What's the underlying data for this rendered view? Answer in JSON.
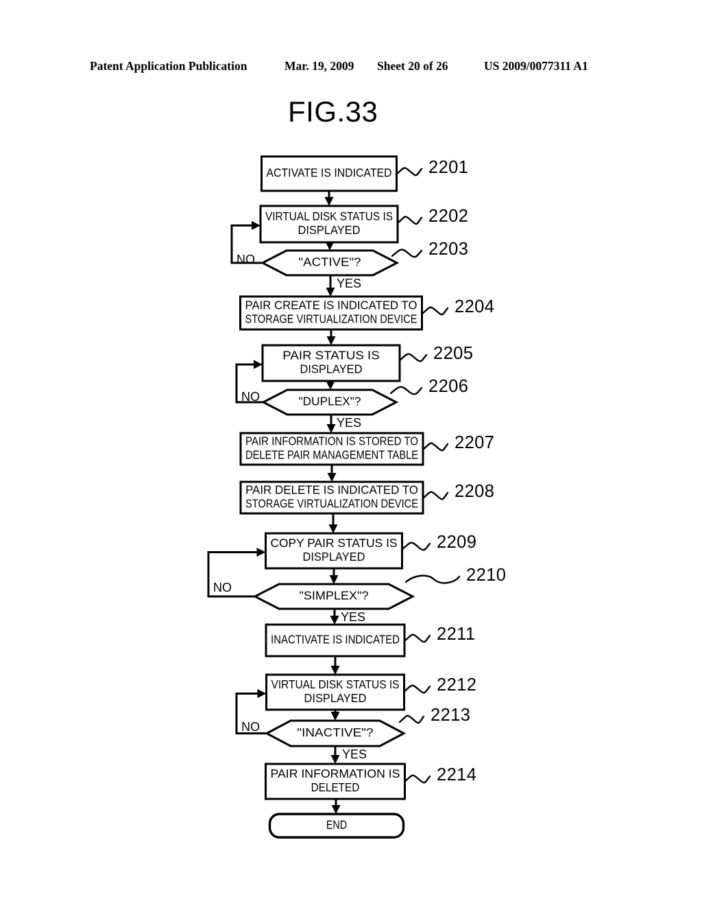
{
  "header": {
    "publication": "Patent Application Publication",
    "date": "Mar. 19, 2009",
    "sheet": "Sheet 20 of 26",
    "patent_number": "US 2009/0077311 A1"
  },
  "figure": {
    "title": "FIG.33",
    "ink_color": "#000000",
    "background_color": "#ffffff"
  },
  "flowchart": {
    "nodes": [
      {
        "id": "n2201",
        "ref": "2201",
        "shape": "process",
        "lines": [
          "ACTIVATE IS INDICATED"
        ]
      },
      {
        "id": "n2202",
        "ref": "2202",
        "shape": "process",
        "lines": [
          "VIRTUAL DISK STATUS IS",
          "DISPLAYED"
        ]
      },
      {
        "id": "n2203",
        "ref": "2203",
        "shape": "decision",
        "lines": [
          "\"ACTIVE\"?"
        ]
      },
      {
        "id": "n2204",
        "ref": "2204",
        "shape": "process",
        "lines": [
          "PAIR CREATE IS INDICATED TO",
          "STORAGE VIRTUALIZATION DEVICE"
        ]
      },
      {
        "id": "n2205",
        "ref": "2205",
        "shape": "process",
        "lines": [
          "PAIR STATUS IS",
          "DISPLAYED"
        ]
      },
      {
        "id": "n2206",
        "ref": "2206",
        "shape": "decision",
        "lines": [
          "\"DUPLEX\"?"
        ]
      },
      {
        "id": "n2207",
        "ref": "2207",
        "shape": "process",
        "lines": [
          "PAIR INFORMATION IS STORED TO",
          "DELETE PAIR MANAGEMENT TABLE"
        ]
      },
      {
        "id": "n2208",
        "ref": "2208",
        "shape": "process",
        "lines": [
          "PAIR DELETE IS INDICATED TO",
          "STORAGE VIRTUALIZATION DEVICE"
        ]
      },
      {
        "id": "n2209",
        "ref": "2209",
        "shape": "process",
        "lines": [
          "COPY PAIR STATUS IS",
          "DISPLAYED"
        ]
      },
      {
        "id": "n2210",
        "ref": "2210",
        "shape": "decision",
        "lines": [
          "\"SIMPLEX\"?"
        ]
      },
      {
        "id": "n2211",
        "ref": "2211",
        "shape": "process",
        "lines": [
          "INACTIVATE IS INDICATED"
        ]
      },
      {
        "id": "n2212",
        "ref": "2212",
        "shape": "process",
        "lines": [
          "VIRTUAL DISK STATUS IS",
          "DISPLAYED"
        ]
      },
      {
        "id": "n2213",
        "ref": "2213",
        "shape": "decision",
        "lines": [
          "\"INACTIVE\"?"
        ]
      },
      {
        "id": "n2214",
        "ref": "2214",
        "shape": "process",
        "lines": [
          "PAIR INFORMATION IS",
          "DELETED"
        ]
      },
      {
        "id": "nend",
        "ref": "",
        "shape": "terminator",
        "lines": [
          "END"
        ]
      }
    ],
    "branch_labels": {
      "yes": "YES",
      "no": "NO"
    },
    "edges": [
      {
        "from": "n2201",
        "to": "n2202",
        "label": ""
      },
      {
        "from": "n2202",
        "to": "n2203",
        "label": ""
      },
      {
        "from": "n2203",
        "to": "n2204",
        "label": "YES"
      },
      {
        "from": "n2203",
        "to": "n2202",
        "label": "NO"
      },
      {
        "from": "n2204",
        "to": "n2205",
        "label": ""
      },
      {
        "from": "n2205",
        "to": "n2206",
        "label": ""
      },
      {
        "from": "n2206",
        "to": "n2207",
        "label": "YES"
      },
      {
        "from": "n2206",
        "to": "n2205",
        "label": "NO"
      },
      {
        "from": "n2207",
        "to": "n2208",
        "label": ""
      },
      {
        "from": "n2208",
        "to": "n2209",
        "label": ""
      },
      {
        "from": "n2209",
        "to": "n2210",
        "label": ""
      },
      {
        "from": "n2210",
        "to": "n2211",
        "label": "YES"
      },
      {
        "from": "n2210",
        "to": "n2209",
        "label": "NO"
      },
      {
        "from": "n2211",
        "to": "n2212",
        "label": ""
      },
      {
        "from": "n2212",
        "to": "n2213",
        "label": ""
      },
      {
        "from": "n2213",
        "to": "n2214",
        "label": "YES"
      },
      {
        "from": "n2213",
        "to": "n2212",
        "label": "NO"
      },
      {
        "from": "n2214",
        "to": "nend",
        "label": ""
      }
    ]
  }
}
